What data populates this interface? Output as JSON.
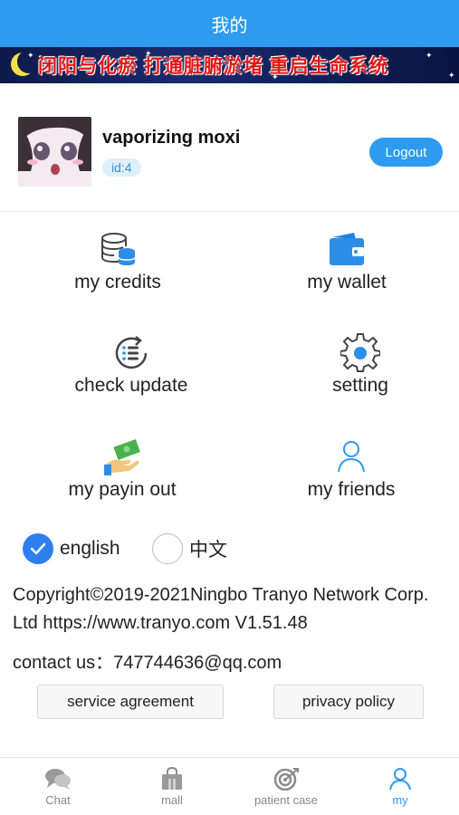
{
  "header": {
    "title": "我的"
  },
  "banner": {
    "text": "闭阳与化瘀 打通脏腑淤堵 重启生命系统"
  },
  "profile": {
    "username": "vaporizing moxi",
    "id_label": "id:4",
    "logout_label": "Logout"
  },
  "menu": {
    "credits": "my credits",
    "wallet": "my wallet",
    "check_update": "check update",
    "setting": "setting",
    "payin_out": "my payin out",
    "friends": "my friends"
  },
  "language": {
    "selected": "english",
    "options": [
      "english",
      "中文"
    ]
  },
  "footer": {
    "copyright": "Copyright©2019-2021Ningbo Tranyo Network Corp. Ltd https://www.tranyo.com V1.51.48",
    "contact": "contact us：747744636@qq.com",
    "service_agreement": "service agreement",
    "privacy_policy": "privacy policy"
  },
  "tabs": [
    {
      "label": "Chat",
      "icon": "chat-icon"
    },
    {
      "label": "mall",
      "icon": "shopping-bag-icon"
    },
    {
      "label": "patient case",
      "icon": "target-icon"
    },
    {
      "label": "my",
      "icon": "person-icon",
      "active": true
    }
  ],
  "colors": {
    "primary": "#2d9bf0",
    "accent": "#2d7ff0"
  }
}
